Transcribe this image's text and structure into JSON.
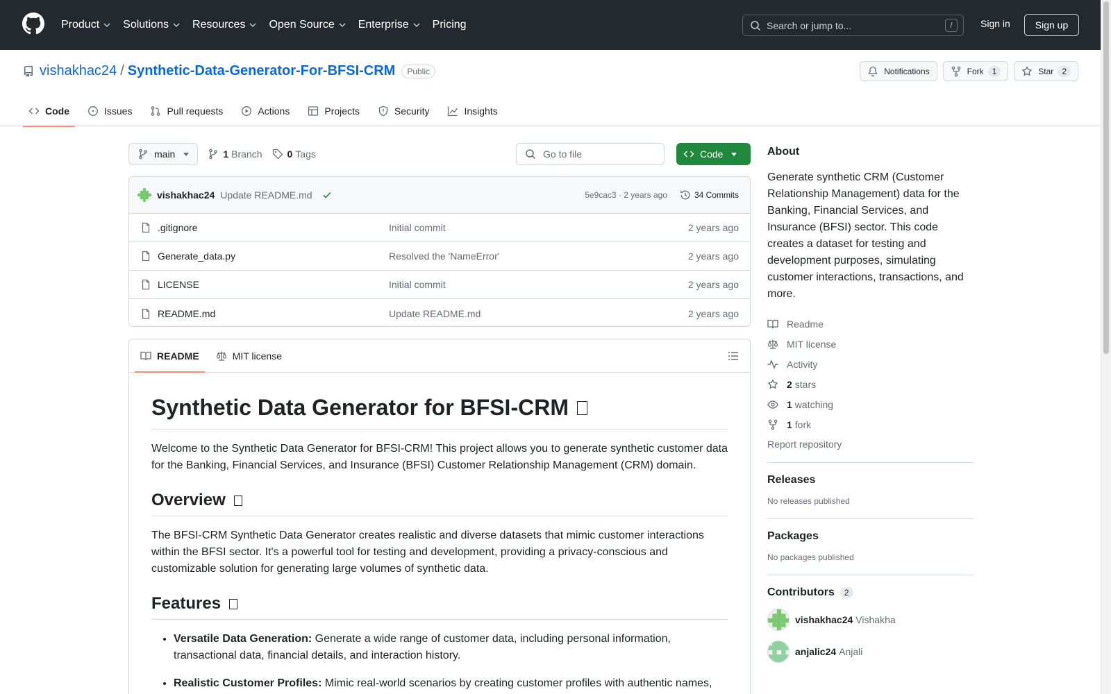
{
  "header": {
    "nav": [
      "Product",
      "Solutions",
      "Resources",
      "Open Source",
      "Enterprise",
      "Pricing"
    ],
    "search_placeholder": "Search or jump to...",
    "search_shortcut": "/",
    "sign_in": "Sign in",
    "sign_up": "Sign up"
  },
  "repo": {
    "owner": "vishakhac24",
    "separator": "/",
    "name": "Synthetic-Data-Generator-For-BFSI-CRM",
    "visibility": "Public",
    "notifications_label": "Notifications",
    "fork_label": "Fork",
    "fork_count": "1",
    "star_label": "Star",
    "star_count": "2",
    "tabs": [
      "Code",
      "Issues",
      "Pull requests",
      "Actions",
      "Projects",
      "Security",
      "Insights"
    ]
  },
  "filenav": {
    "branch": "main",
    "branch_count": "1",
    "branch_label": "Branch",
    "tag_count": "0",
    "tag_label": "Tags",
    "goto_placeholder": "Go to file",
    "code_button": "Code"
  },
  "commit": {
    "author": "vishakhac24",
    "message": "Update README.md",
    "hash_age": "5e9cac3 · 2 years ago",
    "commits": "34 Commits"
  },
  "files": [
    {
      "name": ".gitignore",
      "message": "Initial commit",
      "age": "2 years ago"
    },
    {
      "name": "Generate_data.py",
      "message": "Resolved the 'NameError'",
      "age": "2 years ago"
    },
    {
      "name": "LICENSE",
      "message": "Initial commit",
      "age": "2 years ago"
    },
    {
      "name": "README.md",
      "message": "Update README.md",
      "age": "2 years ago"
    }
  ],
  "readme": {
    "tab_readme": "README",
    "tab_license": "MIT license",
    "title": "Synthetic Data Generator for BFSI-CRM",
    "intro": "Welcome to the Synthetic Data Generator for BFSI-CRM! This project allows you to generate synthetic customer data for the Banking, Financial Services, and Insurance (BFSI) Customer Relationship Management (CRM) domain.",
    "overview_heading": "Overview",
    "overview_text": "The BFSI-CRM Synthetic Data Generator creates realistic and diverse datasets that mimic customer interactions within the BFSI sector. It's a powerful tool for testing and development, providing a privacy-conscious and customizable solution for generating large volumes of synthetic data.",
    "features_heading": "Features",
    "features": [
      {
        "title": "Versatile Data Generation:",
        "text": " Generate a wide range of customer data, including personal information, transactional data, financial details, and interaction history."
      },
      {
        "title": "Realistic Customer Profiles:",
        "text": " Mimic real-world scenarios by creating customer profiles with authentic names,"
      }
    ]
  },
  "sidebar": {
    "about_heading": "About",
    "about_text": "Generate synthetic CRM (Customer Relationship Management) data for the Banking, Financial Services, and Insurance (BFSI) sector. This code creates a dataset for testing and development purposes, simulating customer interactions, transactions, and more.",
    "readme": "Readme",
    "license": "MIT license",
    "activity": "Activity",
    "stars_count": "2",
    "stars_label": "stars",
    "watching_count": "1",
    "watching_label": "watching",
    "fork_count": "1",
    "fork_label": "fork",
    "report": "Report repository",
    "releases_heading": "Releases",
    "releases_text": "No releases published",
    "packages_heading": "Packages",
    "packages_text": "No packages published",
    "contributors_heading": "Contributors",
    "contributors_count": "2",
    "contributors": [
      {
        "login": "vishakhac24",
        "name": "Vishakha"
      },
      {
        "login": "anjalic24",
        "name": "Anjali"
      }
    ]
  },
  "colors": {
    "header_bg": "#24292f",
    "link": "#0969da",
    "primary_button": "#1f883d",
    "tab_underline": "#fd8c73",
    "success_check": "#1a7f37"
  }
}
